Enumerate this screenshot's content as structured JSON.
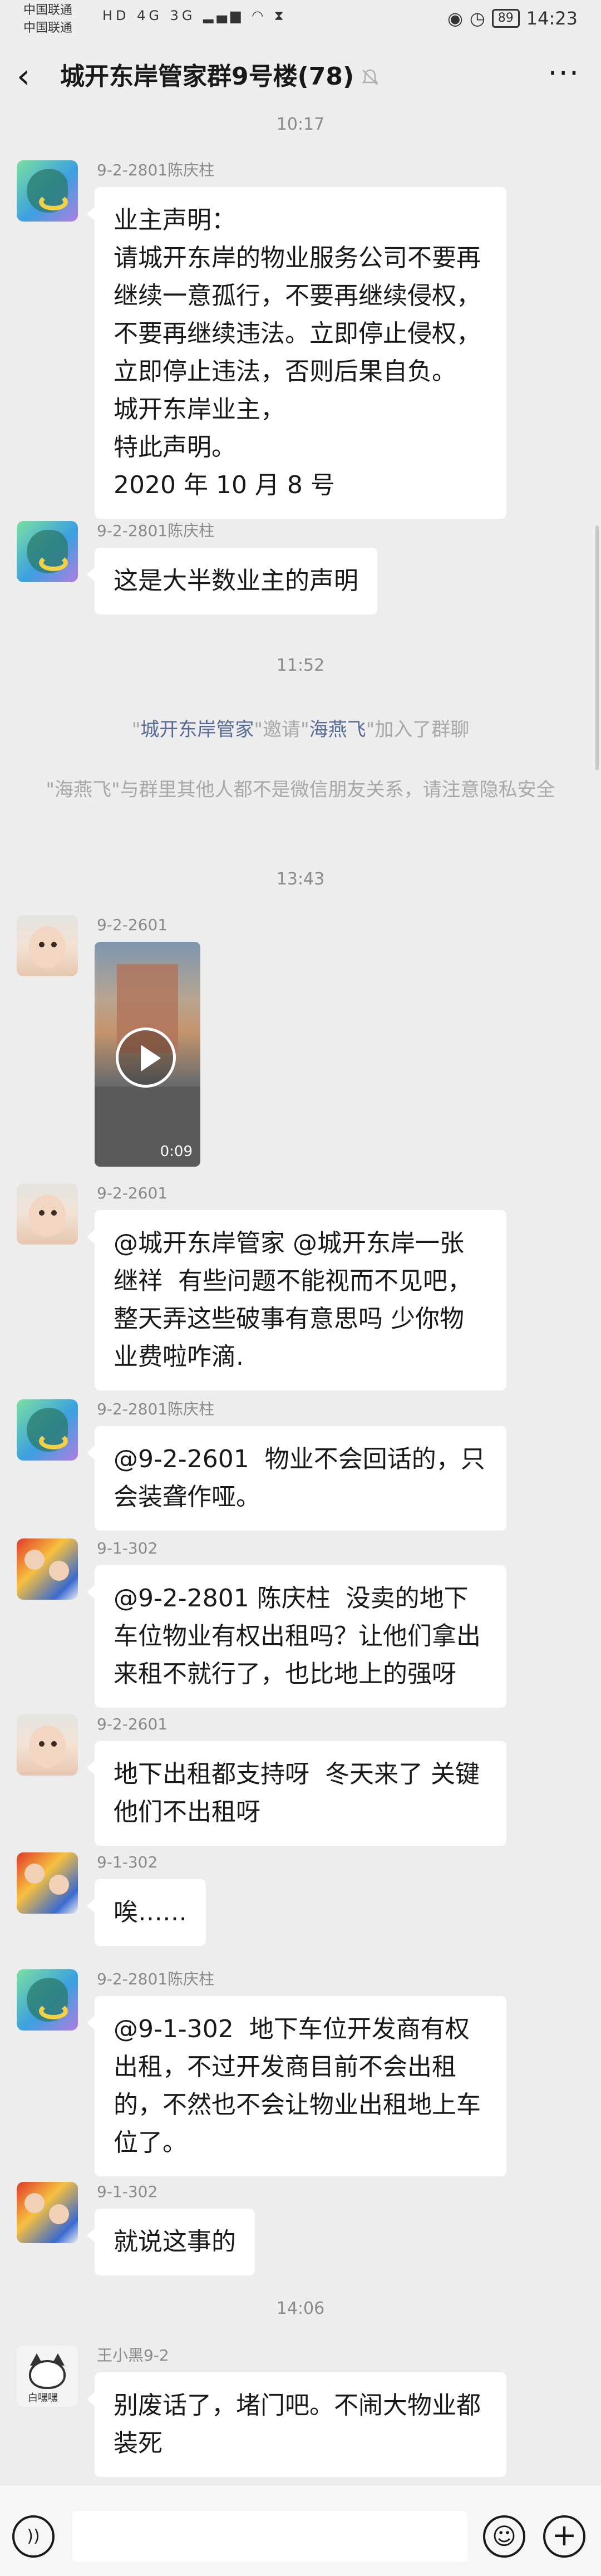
{
  "status_bar": {
    "carrier1": "中国联通",
    "carrier2": "中国联通",
    "left_icons": "HD 4G 3G",
    "battery": "89",
    "time": "14:23"
  },
  "header": {
    "title": "城开东岸管家群9号楼(78)",
    "back_icon": "back-arrow-icon",
    "muted_icon": "bell-muted-icon",
    "more_icon": "more-dots-icon"
  },
  "times": [
    "10:17",
    "11:52",
    "13:43",
    "14:06"
  ],
  "system": {
    "invite_prefix": "\"",
    "inviter": "城开东岸管家",
    "invite_mid": "\"邀请\"",
    "invitee": "海燕飞",
    "invite_suffix": "\"加入了群聊",
    "notice_prefix": "\"",
    "notice_name": "海燕飞",
    "notice_rest": "\"与群里其他人都不是微信朋友关系，请注意隐私安全"
  },
  "messages": [
    {
      "sender": "9-2-2801陈庆柱",
      "avatar": "dragon-avatar",
      "text": "业主声明：\n请城开东岸的物业服务公司不要再继续一意孤行，不要再继续侵权，不要再继续违法。立即停止侵权，立即停止违法，否则后果自负。\n城开东岸业主，\n特此声明。\n2020 年 10 月 8 号"
    },
    {
      "sender": "9-2-2801陈庆柱",
      "avatar": "dragon-avatar",
      "text": "这是大半数业主的声明"
    },
    {
      "sender": "9-2-2601",
      "avatar": "baby-avatar",
      "video_duration": "0:09"
    },
    {
      "sender": "9-2-2601",
      "avatar": "baby-avatar",
      "text": "@城开东岸管家 @城开东岸一张继祥  有些问题不能视而不见吧，  整天弄这些破事有意思吗 少你物业费啦咋滴."
    },
    {
      "sender": "9-2-2801陈庆柱",
      "avatar": "dragon-avatar",
      "text": "@9-2-2601  物业不会回话的，只会装聋作哑。"
    },
    {
      "sender": "9-1-302",
      "avatar": "kids-avatar",
      "text": "@9-2-2801 陈庆柱  没卖的地下车位物业有权出租吗？让他们拿出来租不就行了，也比地上的强呀"
    },
    {
      "sender": "9-2-2601",
      "avatar": "baby-avatar",
      "text": "地下出租都支持呀  冬天来了 关键他们不出租呀"
    },
    {
      "sender": "9-1-302",
      "avatar": "kids-avatar",
      "text": "唉……"
    },
    {
      "sender": "9-2-2801陈庆柱",
      "avatar": "dragon-avatar",
      "text": "@9-1-302  地下车位开发商有权出租，不过开发商目前不会出租的，不然也不会让物业出租地上车位了。"
    },
    {
      "sender": "9-1-302",
      "avatar": "kids-avatar",
      "text": "就说这事的"
    },
    {
      "sender": "王小黑9-2",
      "avatar": "cat-avatar",
      "avatar_text": "白嘿嘿",
      "text": "别废话了，堵门吧。不闹大物业都装死"
    }
  ],
  "input_bar": {
    "voice_icon": "voice-icon",
    "placeholder": "",
    "emoji_icon": "emoji-icon",
    "plus_icon": "plus-icon"
  }
}
